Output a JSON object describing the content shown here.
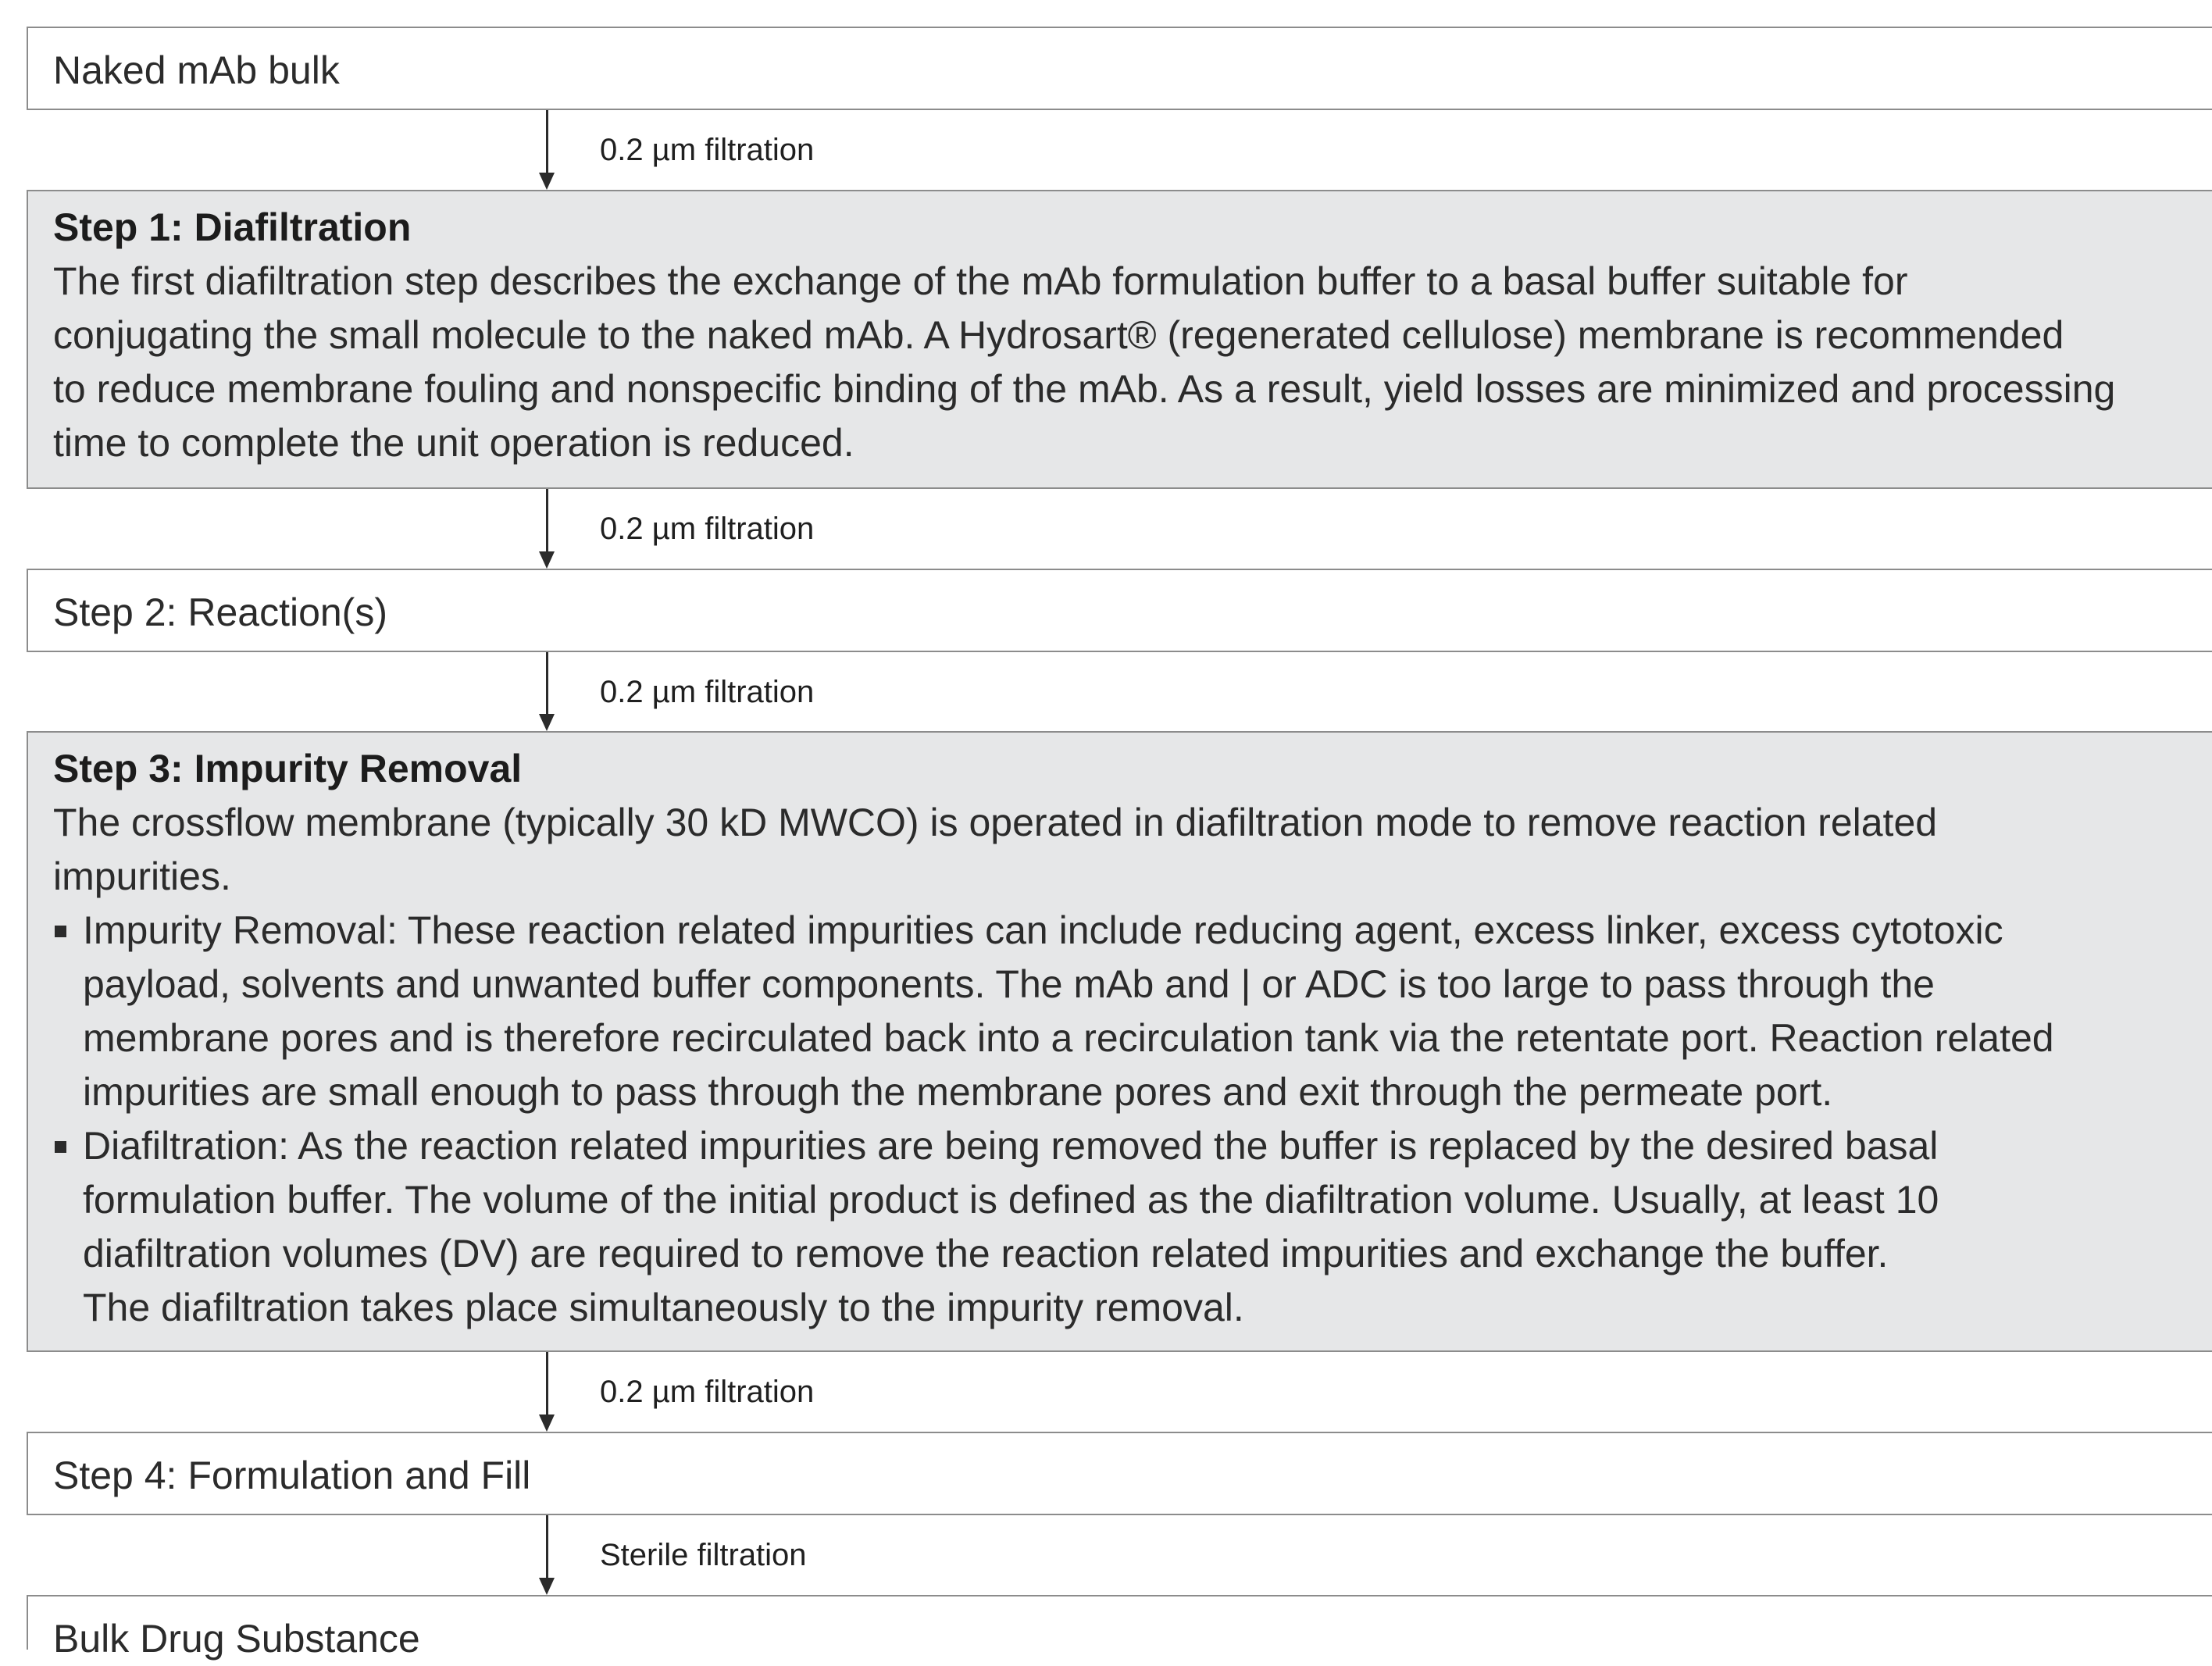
{
  "steps": [
    {
      "title": "Naked mAb bulk"
    },
    {
      "title": "Step 1: Diafiltration",
      "paragraph": [
        "The first diafiltration step describes the exchange of the mAb formulation buffer to a basal buffer suitable for",
        "conjugating the small molecule to the naked mAb. A Hydrosart® (regenerated cellulose) membrane is recommended",
        "to reduce membrane fouling and nonspecific binding of the mAb. As a result, yield losses are minimized and processing",
        "time to complete the unit operation is reduced."
      ]
    },
    {
      "title": "Step 2: Reaction(s)"
    },
    {
      "title": "Step 3: Impurity Removal",
      "paragraph": [
        "The crossflow membrane (typically 30 kD MWCO) is operated in diafiltration mode to remove reaction related",
        "impurities."
      ],
      "bullets": [
        [
          "Impurity Removal: These reaction related impurities can include reducing agent, excess linker, excess cytotoxic",
          "payload, solvents and unwanted buffer components. The mAb and | or ADC is too large to pass through the",
          "membrane pores and is therefore recirculated back into a recirculation tank via the retentate port. Reaction related",
          "impurities are small enough to pass through the membrane pores and exit through the permeate port."
        ],
        [
          "Diafiltration: As the reaction related impurities are being removed the buffer is replaced by the desired basal",
          "formulation buffer. The volume of the initial product is defined as the diafiltration volume. Usually, at least 10",
          "diafiltration volumes (DV) are required to remove the reaction related impurities and exchange the buffer.",
          "The diafiltration takes place simultaneously to the impurity removal."
        ]
      ]
    },
    {
      "title": "Step 4: Formulation and Fill"
    },
    {
      "title": "Bulk Drug Substance"
    }
  ],
  "connectors": [
    {
      "label": "0.2 µm filtration"
    },
    {
      "label": "0.2 µm filtration"
    },
    {
      "label": "0.2 µm filtration"
    },
    {
      "label": "0.2 µm filtration"
    },
    {
      "label": "Sterile filtration"
    }
  ]
}
